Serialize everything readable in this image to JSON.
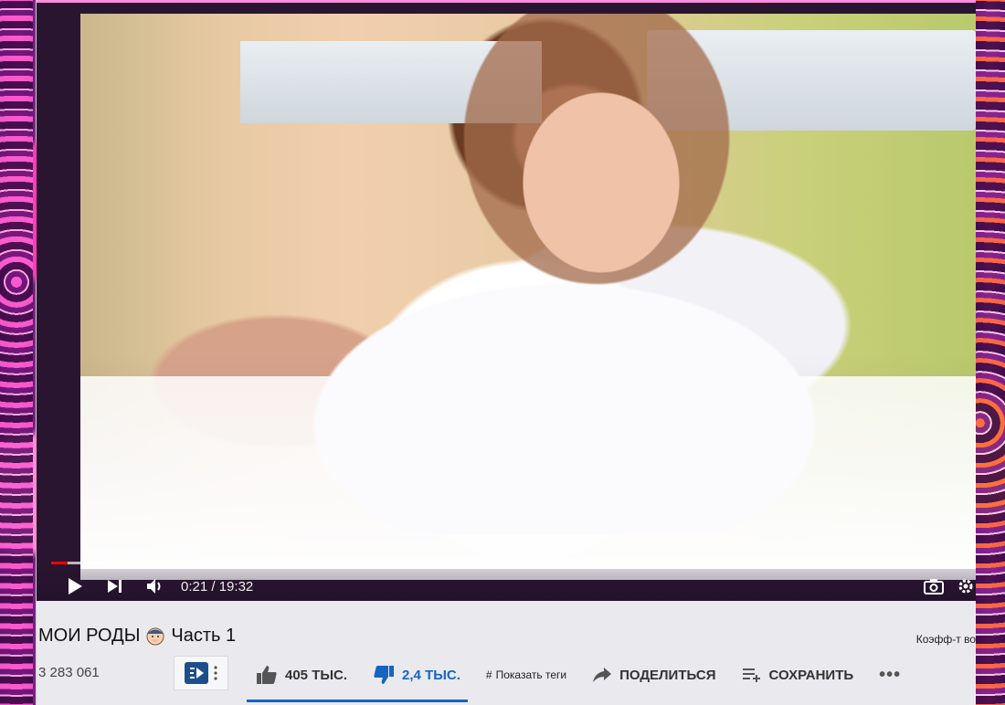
{
  "player": {
    "current_time": "0:21",
    "duration": "19:32",
    "time_separator": " / ",
    "progress_played": 0.018,
    "progress_buffered": 0.058
  },
  "video": {
    "title": "МОИ РОДЫ",
    "title_suffix": "Часть 1",
    "views": "3 283 061",
    "coefficient_label": "Коэфф-т во"
  },
  "actions": {
    "like_count": "405 ТЫС.",
    "dislike_count": "2,4 ТЫС.",
    "tags_label": "Показать теги",
    "tags_hash": "#",
    "share_label": "ПОДЕЛИТЬСЯ",
    "save_label": "СОХРАНИТЬ",
    "more_label": "•••"
  },
  "colors": {
    "progress_red": "#ff0000",
    "dislike_blue": "#1565c0",
    "info_bg": "#e9e9ee"
  },
  "icons": [
    "play-icon",
    "next-icon",
    "volume-icon",
    "screenshot-icon",
    "settings-icon",
    "like-icon",
    "dislike-icon",
    "share-icon",
    "playlist-add-icon",
    "more-icon",
    "extension-icon"
  ]
}
